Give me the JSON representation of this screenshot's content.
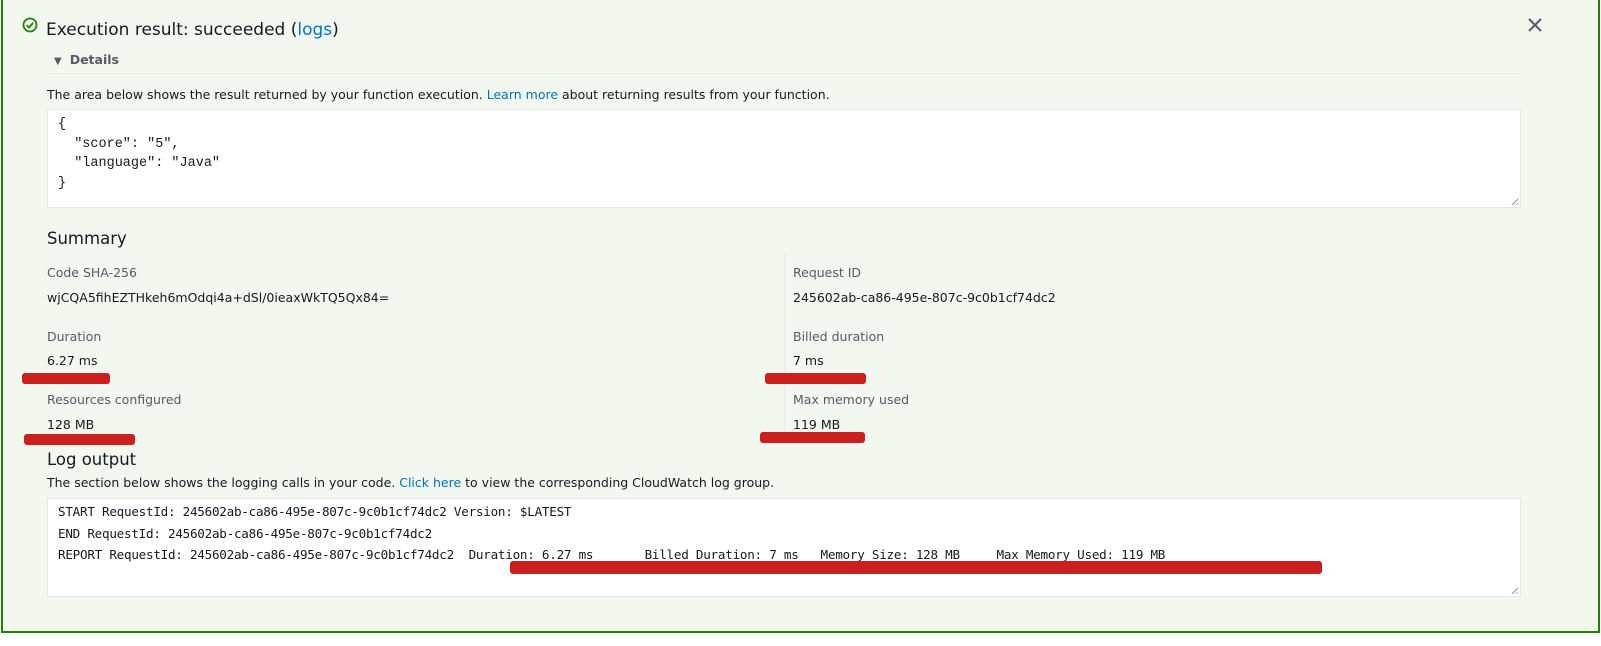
{
  "header": {
    "title_prefix": "Execution result: succeeded (",
    "logs_link": "logs",
    "title_suffix": ")",
    "status_icon": "check-circle-icon",
    "close_icon": "close-icon",
    "status_color": "#1d8102"
  },
  "details": {
    "toggle_label": "Details",
    "description_prefix": "The area below shows the result returned by your function execution. ",
    "learn_more_link": "Learn more",
    "description_suffix": " about returning results from your function.",
    "result_text": "{\n  \"score\": \"5\",\n  \"language\": \"Java\"\n}"
  },
  "summary": {
    "heading": "Summary",
    "fields": [
      {
        "label": "Code SHA-256",
        "value": "wjCQA5fihEZTHkeh6mOdqi4a+dSl/0ieaxWkTQ5Qx84="
      },
      {
        "label": "Request ID",
        "value": "245602ab-ca86-495e-807c-9c0b1cf74dc2"
      },
      {
        "label": "Duration",
        "value": "6.27 ms"
      },
      {
        "label": "Billed duration",
        "value": "7 ms"
      },
      {
        "label": "Resources configured",
        "value": "128 MB"
      },
      {
        "label": "Max memory used",
        "value": "119 MB"
      }
    ]
  },
  "log_output": {
    "heading": "Log output",
    "description_prefix": "The section below shows the logging calls in your code. ",
    "click_here_link": "Click here",
    "description_suffix": " to view the corresponding CloudWatch log group.",
    "log_text": "START RequestId: 245602ab-ca86-495e-807c-9c0b1cf74dc2 Version: $LATEST\nEND RequestId: 245602ab-ca86-495e-807c-9c0b1cf74dc2\nREPORT RequestId: 245602ab-ca86-495e-807c-9c0b1cf74dc2  Duration: 6.27 ms       Billed Duration: 7 ms   Memory Size: 128 MB     Max Memory Used: 119 MB"
  }
}
